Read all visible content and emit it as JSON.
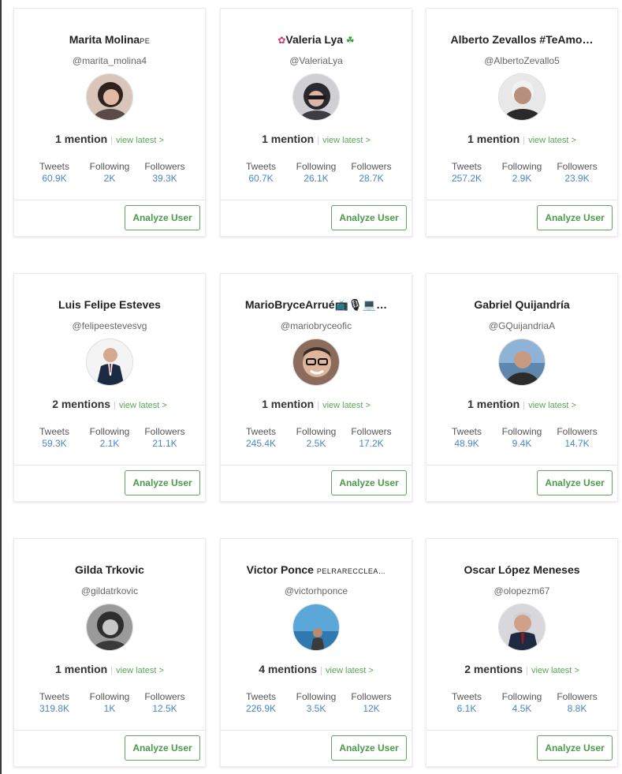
{
  "users": [
    {
      "name": "Marita Molina",
      "name_suffix": "PE",
      "handle": "@marita_molina4",
      "mentions": "1 mention",
      "view_latest": "view latest >",
      "tweets_label": "Tweets",
      "tweets": "60.9K",
      "following_label": "Following",
      "following": "2K",
      "followers_label": "Followers",
      "followers": "39.3K",
      "button": "Analyze User"
    },
    {
      "name": "Valeria Lya",
      "handle": "@ValeriaLya",
      "mentions": "1 mention",
      "view_latest": "view latest >",
      "tweets_label": "Tweets",
      "tweets": "60.7K",
      "following_label": "Following",
      "following": "26.1K",
      "followers_label": "Followers",
      "followers": "28.7K",
      "button": "Analyze User"
    },
    {
      "name": "Alberto Zevallos #TeAmo…",
      "handle": "@AlbertoZevallo5",
      "mentions": "1 mention",
      "view_latest": "view latest >",
      "tweets_label": "Tweets",
      "tweets": "257.2K",
      "following_label": "Following",
      "following": "2.9K",
      "followers_label": "Followers",
      "followers": "23.9K",
      "button": "Analyze User"
    },
    {
      "name": "Luis Felipe Esteves",
      "handle": "@felipeestevesvg",
      "mentions": "2 mentions",
      "view_latest": "view latest >",
      "tweets_label": "Tweets",
      "tweets": "59.3K",
      "following_label": "Following",
      "following": "2.1K",
      "followers_label": "Followers",
      "followers": "21.1K",
      "button": "Analyze User"
    },
    {
      "name": "MarioBryceArrué",
      "name_emoji": "📺🎙💻…",
      "handle": "@mariobryceofic",
      "mentions": "1 mention",
      "view_latest": "view latest >",
      "tweets_label": "Tweets",
      "tweets": "245.4K",
      "following_label": "Following",
      "following": "2.5K",
      "followers_label": "Followers",
      "followers": "17.2K",
      "button": "Analyze User"
    },
    {
      "name": "Gabriel Quijandría",
      "handle": "@GQuijandriaA",
      "mentions": "1 mention",
      "view_latest": "view latest >",
      "tweets_label": "Tweets",
      "tweets": "48.9K",
      "following_label": "Following",
      "following": "9.4K",
      "followers_label": "Followers",
      "followers": "14.7K",
      "button": "Analyze User"
    },
    {
      "name": "Gilda Trkovic",
      "handle": "@gildatrkovic",
      "mentions": "1 mention",
      "view_latest": "view latest >",
      "tweets_label": "Tweets",
      "tweets": "319.8K",
      "following_label": "Following",
      "following": "1K",
      "followers_label": "Followers",
      "followers": "12.5K",
      "button": "Analyze User"
    },
    {
      "name": "Victor Ponce",
      "name_suffix": "PELRARECCLEA…",
      "handle": "@victorhponce",
      "mentions": "4 mentions",
      "view_latest": "view latest >",
      "tweets_label": "Tweets",
      "tweets": "226.9K",
      "following_label": "Following",
      "following": "3.5K",
      "followers_label": "Followers",
      "followers": "12K",
      "button": "Analyze User"
    },
    {
      "name": "Oscar López Meneses",
      "handle": "@olopezm67",
      "mentions": "2 mentions",
      "view_latest": "view latest >",
      "tweets_label": "Tweets",
      "tweets": "6.1K",
      "following_label": "Following",
      "following": "4.5K",
      "followers_label": "Followers",
      "followers": "8.8K",
      "button": "Analyze User"
    }
  ]
}
